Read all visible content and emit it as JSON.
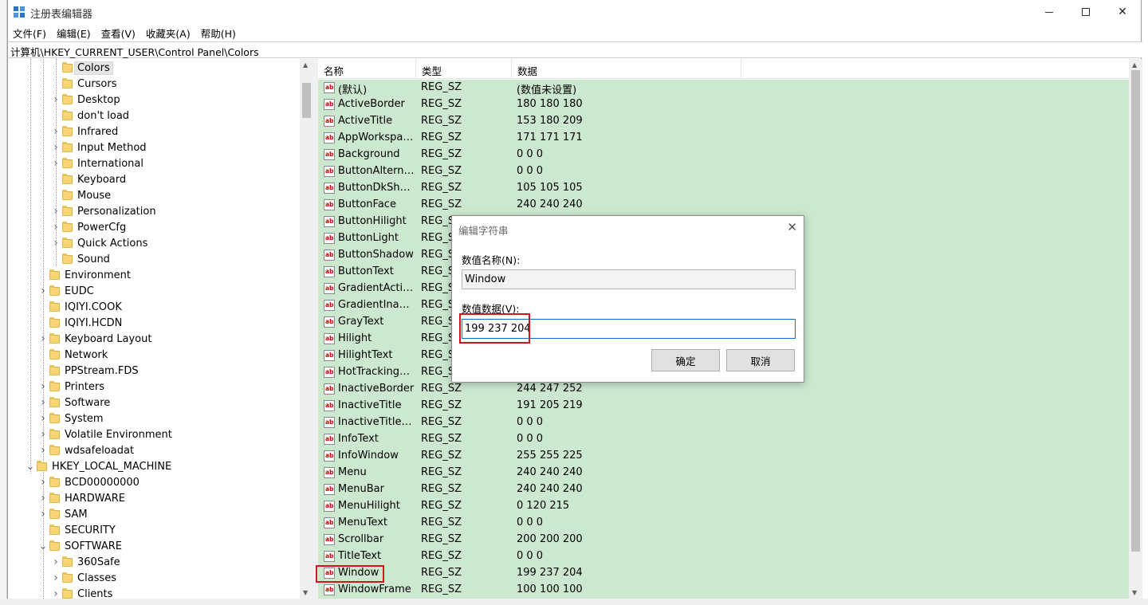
{
  "window": {
    "title": "注册表编辑器",
    "close_glyph": "✕"
  },
  "menu": [
    "文件(F)",
    "编辑(E)",
    "查看(V)",
    "收藏夹(A)",
    "帮助(H)"
  ],
  "address": "计算机\\HKEY_CURRENT_USER\\Control Panel\\Colors",
  "tree": {
    "items": [
      {
        "label": "Colors",
        "level": 2,
        "expandable": false,
        "selected": true
      },
      {
        "label": "Cursors",
        "level": 2,
        "expandable": false
      },
      {
        "label": "Desktop",
        "level": 2,
        "expandable": true
      },
      {
        "label": "don't load",
        "level": 2,
        "expandable": false
      },
      {
        "label": "Infrared",
        "level": 2,
        "expandable": true
      },
      {
        "label": "Input Method",
        "level": 2,
        "expandable": true
      },
      {
        "label": "International",
        "level": 2,
        "expandable": true
      },
      {
        "label": "Keyboard",
        "level": 2,
        "expandable": false
      },
      {
        "label": "Mouse",
        "level": 2,
        "expandable": false
      },
      {
        "label": "Personalization",
        "level": 2,
        "expandable": true
      },
      {
        "label": "PowerCfg",
        "level": 2,
        "expandable": true
      },
      {
        "label": "Quick Actions",
        "level": 2,
        "expandable": true
      },
      {
        "label": "Sound",
        "level": 2,
        "expandable": false
      },
      {
        "label": "Environment",
        "level": 1,
        "expandable": false
      },
      {
        "label": "EUDC",
        "level": 1,
        "expandable": true
      },
      {
        "label": "IQIYI.COOK",
        "level": 1,
        "expandable": false
      },
      {
        "label": "IQIYI.HCDN",
        "level": 1,
        "expandable": false
      },
      {
        "label": "Keyboard Layout",
        "level": 1,
        "expandable": true
      },
      {
        "label": "Network",
        "level": 1,
        "expandable": false
      },
      {
        "label": "PPStream.FDS",
        "level": 1,
        "expandable": false
      },
      {
        "label": "Printers",
        "level": 1,
        "expandable": true
      },
      {
        "label": "Software",
        "level": 1,
        "expandable": true
      },
      {
        "label": "System",
        "level": 1,
        "expandable": true
      },
      {
        "label": "Volatile Environment",
        "level": 1,
        "expandable": true
      },
      {
        "label": "wdsafeloadat",
        "level": 1,
        "expandable": true
      },
      {
        "label": "HKEY_LOCAL_MACHINE",
        "level": 0,
        "expandable": true,
        "expanded": true
      },
      {
        "label": "BCD00000000",
        "level": 1,
        "expandable": true
      },
      {
        "label": "HARDWARE",
        "level": 1,
        "expandable": true
      },
      {
        "label": "SAM",
        "level": 1,
        "expandable": true
      },
      {
        "label": "SECURITY",
        "level": 1,
        "expandable": false
      },
      {
        "label": "SOFTWARE",
        "level": 1,
        "expandable": true,
        "expanded": true
      },
      {
        "label": "360Safe",
        "level": 2,
        "expandable": true
      },
      {
        "label": "Classes",
        "level": 2,
        "expandable": true
      },
      {
        "label": "Clients",
        "level": 2,
        "expandable": true
      }
    ]
  },
  "list": {
    "headers": {
      "name": "名称",
      "type": "类型",
      "data": "数据"
    },
    "value_icon_text": "ab",
    "rows": [
      {
        "name": "(默认)",
        "type": "REG_SZ",
        "data": "(数值未设置)"
      },
      {
        "name": "ActiveBorder",
        "type": "REG_SZ",
        "data": "180 180 180"
      },
      {
        "name": "ActiveTitle",
        "type": "REG_SZ",
        "data": "153 180 209"
      },
      {
        "name": "AppWorkspace",
        "type": "REG_SZ",
        "data": "171 171 171"
      },
      {
        "name": "Background",
        "type": "REG_SZ",
        "data": "0 0 0"
      },
      {
        "name": "ButtonAlternat...",
        "type": "REG_SZ",
        "data": "0 0 0"
      },
      {
        "name": "ButtonDkShad...",
        "type": "REG_SZ",
        "data": "105 105 105"
      },
      {
        "name": "ButtonFace",
        "type": "REG_SZ",
        "data": "240 240 240"
      },
      {
        "name": "ButtonHilight",
        "type": "REG_SZ",
        "data": ""
      },
      {
        "name": "ButtonLight",
        "type": "REG_SZ",
        "data": ""
      },
      {
        "name": "ButtonShadow",
        "type": "REG_SZ",
        "data": ""
      },
      {
        "name": "ButtonText",
        "type": "REG_SZ",
        "data": ""
      },
      {
        "name": "GradientActive...",
        "type": "REG_SZ",
        "data": ""
      },
      {
        "name": "GradientInactiv...",
        "type": "REG_SZ",
        "data": ""
      },
      {
        "name": "GrayText",
        "type": "REG_SZ",
        "data": ""
      },
      {
        "name": "Hilight",
        "type": "REG_SZ",
        "data": ""
      },
      {
        "name": "HilightText",
        "type": "REG_SZ",
        "data": ""
      },
      {
        "name": "HotTrackingCo...",
        "type": "REG_SZ",
        "data": ""
      },
      {
        "name": "InactiveBorder",
        "type": "REG_SZ",
        "data": "244 247 252"
      },
      {
        "name": "InactiveTitle",
        "type": "REG_SZ",
        "data": "191 205 219"
      },
      {
        "name": "InactiveTitleText",
        "type": "REG_SZ",
        "data": "0 0 0"
      },
      {
        "name": "InfoText",
        "type": "REG_SZ",
        "data": "0 0 0"
      },
      {
        "name": "InfoWindow",
        "type": "REG_SZ",
        "data": "255 255 225"
      },
      {
        "name": "Menu",
        "type": "REG_SZ",
        "data": "240 240 240"
      },
      {
        "name": "MenuBar",
        "type": "REG_SZ",
        "data": "240 240 240"
      },
      {
        "name": "MenuHilight",
        "type": "REG_SZ",
        "data": "0 120 215"
      },
      {
        "name": "MenuText",
        "type": "REG_SZ",
        "data": "0 0 0"
      },
      {
        "name": "Scrollbar",
        "type": "REG_SZ",
        "data": "200 200 200"
      },
      {
        "name": "TitleText",
        "type": "REG_SZ",
        "data": "0 0 0"
      },
      {
        "name": "Window",
        "type": "REG_SZ",
        "data": "199 237 204"
      },
      {
        "name": "WindowFrame",
        "type": "REG_SZ",
        "data": "100 100 100"
      }
    ]
  },
  "dialog": {
    "title": "编辑字符串",
    "name_label": "数值名称(N):",
    "name_value": "Window",
    "data_label": "数值数据(V):",
    "data_value": "199 237 204",
    "ok_label": "确定",
    "cancel_label": "取消",
    "close_glyph": "✕"
  },
  "colors": {
    "list_background": "#cce8cf",
    "highlight_box": "#d6121a",
    "folder": "#f7d774"
  }
}
